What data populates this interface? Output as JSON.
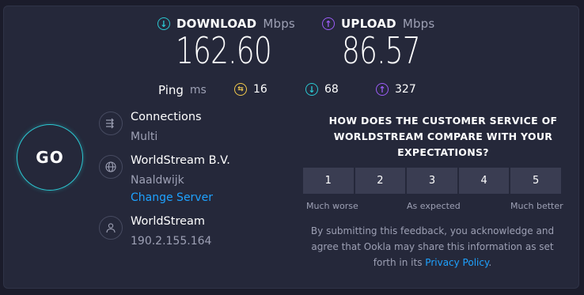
{
  "download": {
    "label": "DOWNLOAD",
    "unit": "Mbps",
    "value": "162.60",
    "icon": "download-icon",
    "color": "#2bc8d2"
  },
  "upload": {
    "label": "UPLOAD",
    "unit": "Mbps",
    "value": "86.57",
    "icon": "upload-icon",
    "color": "#9b5cf6"
  },
  "ping": {
    "label": "Ping",
    "unit": "ms",
    "idle": {
      "value": "16",
      "icon": "ping-icon",
      "color": "#f2c94c"
    },
    "download": {
      "value": "68",
      "icon": "download-icon",
      "color": "#2bc8d2"
    },
    "upload": {
      "value": "327",
      "icon": "upload-icon",
      "color": "#9b5cf6"
    }
  },
  "go_button": {
    "label": "GO"
  },
  "connections": {
    "title": "Connections",
    "value": "Multi",
    "icon": "connections-icon"
  },
  "server": {
    "title": "WorldStream B.V.",
    "location": "Naaldwijk",
    "change_label": "Change Server",
    "icon": "globe-icon"
  },
  "provider": {
    "title": "WorldStream",
    "ip": "190.2.155.164",
    "icon": "user-icon"
  },
  "survey": {
    "question": "HOW DOES THE CUSTOMER SERVICE OF WORLDSTREAM COMPARE WITH YOUR EXPECTATIONS?",
    "options": [
      "1",
      "2",
      "3",
      "4",
      "5"
    ],
    "scale_low": "Much worse",
    "scale_mid": "As expected",
    "scale_high": "Much better",
    "disclaimer": "By submitting this feedback, you acknowledge and agree that Ookla may share this information as set forth in its",
    "privacy_link": "Privacy Policy",
    "period": "."
  }
}
